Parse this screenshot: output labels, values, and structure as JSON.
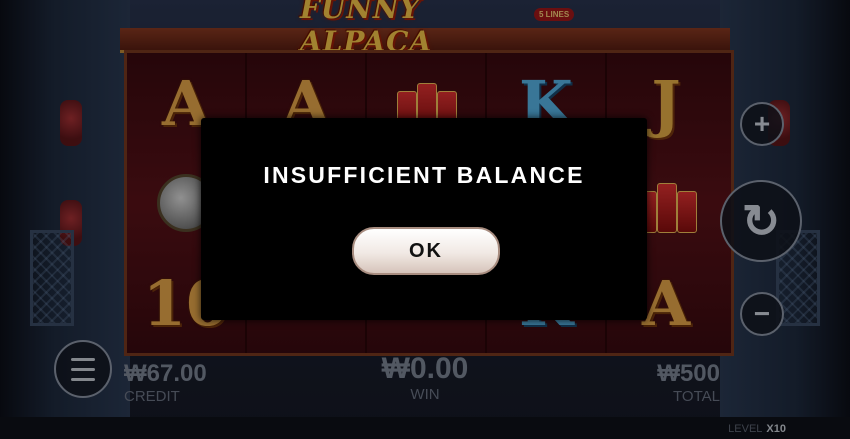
{
  "game": {
    "title": "FUNNY ALPACA",
    "lines_badge": "5 LINES"
  },
  "reels": [
    [
      "A",
      "gong",
      "10"
    ],
    [
      "A",
      "",
      ""
    ],
    [
      "firecrackers",
      "",
      ""
    ],
    [
      "K",
      "",
      "K"
    ],
    [
      "J",
      "firecrackers",
      "A"
    ]
  ],
  "controls": {
    "plus_icon": "plus-icon",
    "minus_icon": "minus-icon",
    "spin_icon": "spin-arrow-icon",
    "menu_icon": "menu-icon"
  },
  "stats": {
    "credit_value": "₩67.00",
    "credit_label": "CREDIT",
    "win_value": "₩0.00",
    "win_label": "WIN",
    "total_value": "₩500",
    "total_label": "TOTAL"
  },
  "level": {
    "label": "LEVEL",
    "value": "X10"
  },
  "dialog": {
    "message": "INSUFFICIENT BALANCE",
    "ok_label": "OK"
  }
}
